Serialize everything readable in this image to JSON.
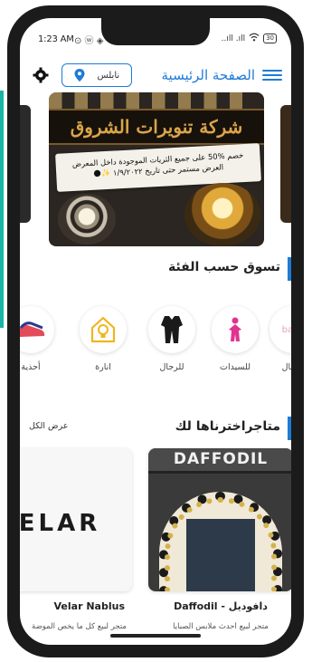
{
  "status_bar": {
    "time": "1:23 AM",
    "left_icons": "⊙ ⓦ ◈",
    "signal": "..ıll .ıll",
    "battery": "30"
  },
  "header": {
    "title": "الصفحة الرئيسية",
    "location": "نابلس"
  },
  "banner": {
    "sign_text": "شركة تنويرات الشروق",
    "offer_line1": "خصم %50 على جميع الثريات الموجودة داخل المعرض",
    "offer_line2": "العرض مستمر حتى تاريخ ١/٩/٢٠٢٢ ✨🌑"
  },
  "categories_section": {
    "title": "تسوق حسب الفئة",
    "items": [
      {
        "label": "أطفال",
        "icon": "baby-icon"
      },
      {
        "label": "للسيدات",
        "icon": "woman-icon"
      },
      {
        "label": "للرجال",
        "icon": "men-clothes-icon"
      },
      {
        "label": "انارة",
        "icon": "lighting-icon"
      },
      {
        "label": "أحذية",
        "icon": "shoes-icon"
      }
    ],
    "baby_icon_text": "baby"
  },
  "stores_section": {
    "title": "متاجراخترناها لك",
    "view_all": "عرض الكل",
    "stores": [
      {
        "name": "Daffodil - دافوديل",
        "description": "متجر لبيع أحدث ملابس الصبايا",
        "sign": "DAFFODIL"
      },
      {
        "name": "Velar Nablus",
        "description": "متجر لبيع كل ما يخص الموضة",
        "logo": "ELAR"
      }
    ]
  },
  "colors": {
    "accent": "#1e7bd6",
    "side_accent": "#18b5a6"
  }
}
